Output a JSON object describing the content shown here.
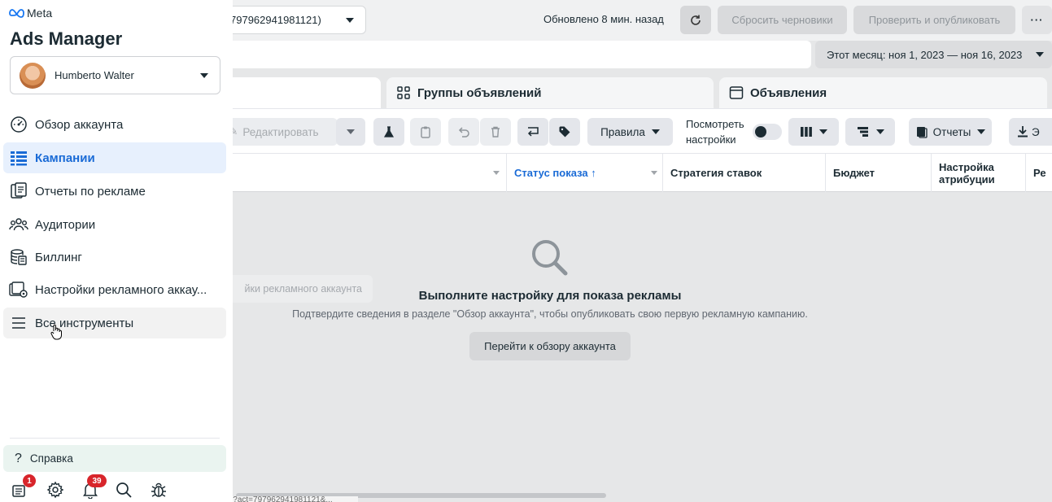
{
  "sidebar": {
    "brand": "Meta",
    "title": "Ads Manager",
    "account_name": "Humberto Walter",
    "nav": [
      {
        "label": "Обзор аккаунта",
        "icon": "gauge-icon"
      },
      {
        "label": "Кампании",
        "icon": "grid-table-icon",
        "active": true
      },
      {
        "label": "Отчеты по рекламе",
        "icon": "reports-icon"
      },
      {
        "label": "Аудитории",
        "icon": "audience-icon"
      },
      {
        "label": "Биллинг",
        "icon": "billing-stack-icon"
      },
      {
        "label": "Настройки рекламного аккау...",
        "icon": "account-settings-icon"
      },
      {
        "label": "Все инструменты",
        "icon": "hamburger-icon"
      }
    ],
    "help_label": "Справка",
    "notifications_badge": "1",
    "alerts_badge": "39"
  },
  "header": {
    "account_id_fragment": "797962941981121)",
    "updated_text": "Обновлено 8 мин. назад",
    "reset_drafts": "Сбросить черновики",
    "review_publish": "Проверить и опубликовать",
    "more": "···",
    "date_range": "Этот месяц: ноя 1, 2023 — ноя 16, 2023"
  },
  "tabs": {
    "ad_sets": "Группы объявлений",
    "ads": "Объявления"
  },
  "toolbar": {
    "edit": "Редактировать",
    "rules": "Правила",
    "view_settings_line1": "Посмотреть",
    "view_settings_line2": "настройки",
    "reports": "Отчеты",
    "export_fragment": "Э"
  },
  "table": {
    "columns": [
      {
        "label": ""
      },
      {
        "label": "Статус показа ↑"
      },
      {
        "label": "Стратегия ставок"
      },
      {
        "label": "Бюджет"
      },
      {
        "label": "Настройка атрибуции"
      },
      {
        "label": "Ре"
      }
    ]
  },
  "empty_state": {
    "title": "Выполните настройку для показа рекламы",
    "subtitle": "Подтвердите сведения в разделе \"Обзор аккаунта\", чтобы опубликовать свою первую рекламную кампанию.",
    "button": "Перейти к обзору аккаунта"
  },
  "tooltip_fragment": "йки рекламного аккаунта",
  "status_url": "https://adsmanager.facebook.com/adsmanager/account_settings?act=797962941981121&..."
}
